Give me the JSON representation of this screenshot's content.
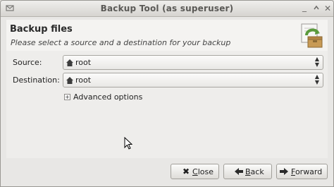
{
  "window": {
    "title": "Backup Tool (as superuser)"
  },
  "header": {
    "title": "Backup files",
    "subtitle": "Please select a source and a destination for your backup",
    "logo_icon": "backup-box-icon"
  },
  "form": {
    "source_label": "Source:",
    "source_value": "root",
    "destination_label": "Destination:",
    "destination_value": "root",
    "advanced_label": "Advanced options"
  },
  "buttons": {
    "close": {
      "icon": "close-icon",
      "access_key": "C",
      "rest": "lose"
    },
    "back": {
      "icon": "arrow-left-icon",
      "access_key": "B",
      "rest": "ack"
    },
    "forward": {
      "icon": "arrow-right-icon",
      "access_key": "F",
      "rest": "orward"
    }
  },
  "colors": {
    "background": "#e8e7e5",
    "header_bg": "#f4f3f1",
    "icon_green": "#6aa84f"
  }
}
